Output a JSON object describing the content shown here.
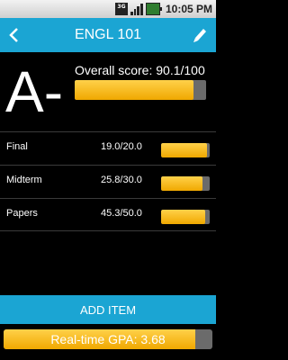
{
  "status_bar": {
    "network_label": "3G",
    "time": "10:05 PM",
    "icons": [
      "3g-icon",
      "signal-icon",
      "battery-icon"
    ]
  },
  "header": {
    "title": "ENGL 101",
    "back_icon": "chevron-left-icon",
    "edit_icon": "pencil-icon",
    "color": "#1BA5D3"
  },
  "summary": {
    "letter_grade": "A-",
    "overall_label": "Overall score: 90.1/100",
    "overall_progress": 0.901
  },
  "items": [
    {
      "name": "Final",
      "score": "19.0/20.0",
      "progress": 0.95
    },
    {
      "name": "Midterm",
      "score": "25.8/30.0",
      "progress": 0.86
    },
    {
      "name": "Papers",
      "score": "45.3/50.0",
      "progress": 0.906
    }
  ],
  "actions": {
    "add_item_label": "ADD ITEM"
  },
  "gpa": {
    "label": "Real-time GPA: 3.68",
    "progress": 0.92
  },
  "colors": {
    "accent": "#1BA5D3",
    "bar_fill": "#F0A800",
    "bar_track": "#6B6B6B",
    "background": "#000000"
  }
}
